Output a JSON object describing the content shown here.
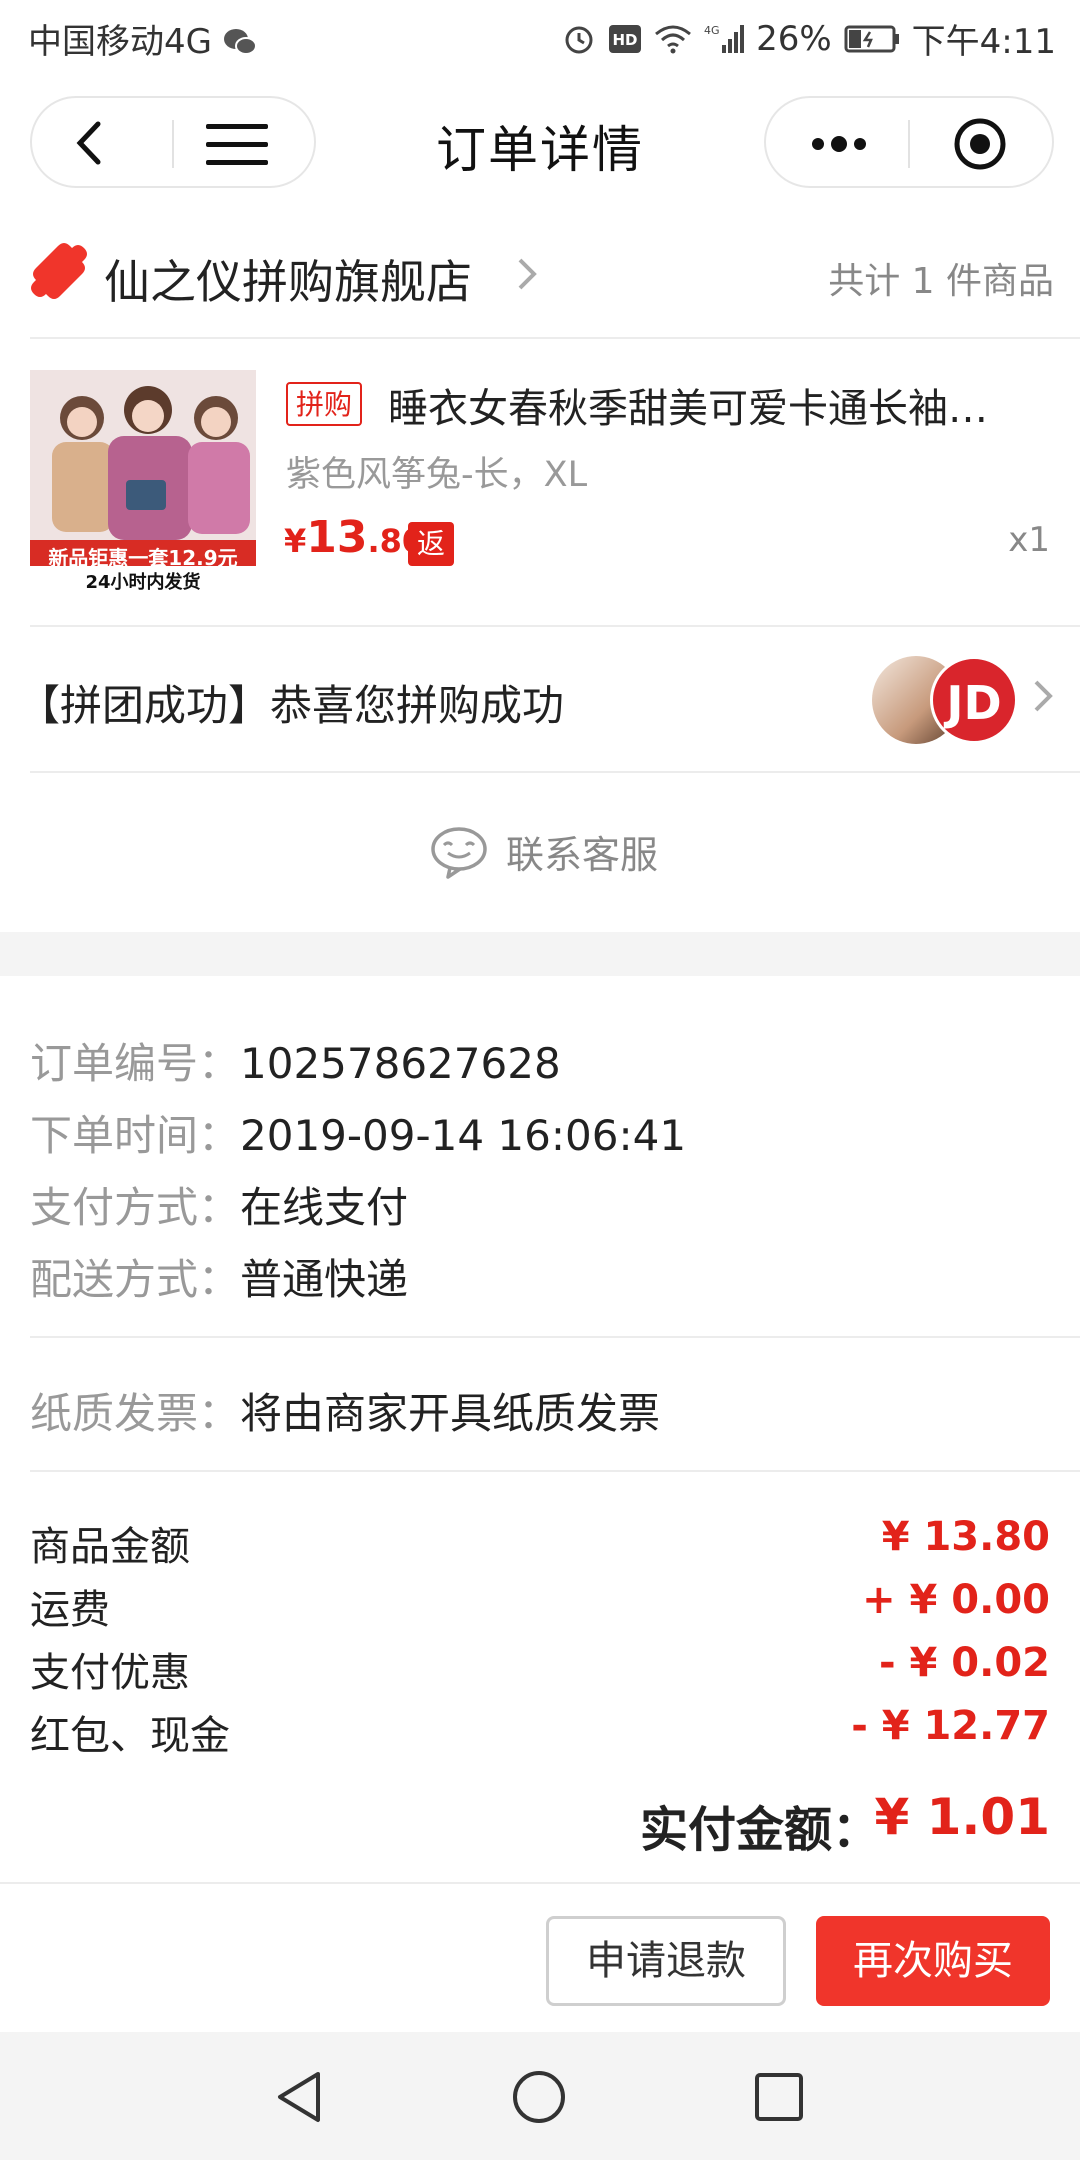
{
  "status_bar": {
    "carrier": "中国移动4G",
    "battery": "26%",
    "time": "下午4:11",
    "icons": [
      "wechat-icon",
      "alarm-icon",
      "hd-icon",
      "wifi-icon",
      "signal-icon",
      "battery-icon"
    ]
  },
  "nav": {
    "title": "订单详情",
    "icons": [
      "back-icon",
      "menu-icon",
      "more-icon",
      "target-icon"
    ]
  },
  "shop": {
    "name": "仙之仪拼购旗舰店",
    "count_text": "共计 1 件商品"
  },
  "product": {
    "tag": "拼购",
    "title": "睡衣女春秋季甜美可爱卡通长袖…",
    "spec": "紫色风筝兔-长，XL",
    "price_symbol": "¥",
    "price_int": "13",
    "price_dec": ".80",
    "rebate_tag": "返",
    "quantity": "x1",
    "image_text": {
      "promo": "新品钜惠一套12.9元",
      "ship": "24小时内发货"
    }
  },
  "group": {
    "message": "【拼团成功】恭喜您拼购成功",
    "avatar2_text": "JD"
  },
  "service": {
    "label": "联系客服"
  },
  "order_info": {
    "rows": [
      {
        "label": "订单编号：",
        "value": "102578627628"
      },
      {
        "label": "下单时间：",
        "value": "2019-09-14 16:06:41"
      },
      {
        "label": "支付方式：",
        "value": "在线支付"
      },
      {
        "label": "配送方式：",
        "value": "普通快递"
      }
    ],
    "invoice": {
      "label": "纸质发票：",
      "value": "将由商家开具纸质发票"
    }
  },
  "amounts": {
    "rows": [
      {
        "label": "商品金额",
        "value": "¥ 13.80"
      },
      {
        "label": "运费",
        "value": "+ ¥ 0.00"
      },
      {
        "label": "支付优惠",
        "value": "- ¥ 0.02"
      },
      {
        "label": "红包、现金",
        "value": "- ¥ 12.77"
      }
    ],
    "total_label": "实付金额：",
    "total_value": "¥ 1.01"
  },
  "actions": {
    "refund": "申请退款",
    "rebuy": "再次购买"
  },
  "colors": {
    "accent": "#e2231a",
    "button": "#f0352b",
    "muted": "#999999"
  }
}
